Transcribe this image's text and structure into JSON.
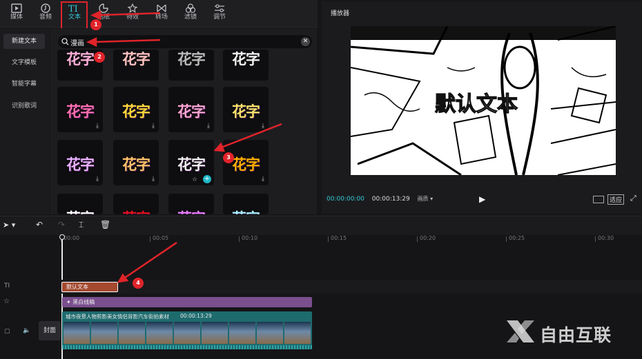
{
  "toolbar": {
    "tabs": [
      {
        "label": "媒体",
        "icon": "media-icon"
      },
      {
        "label": "音频",
        "icon": "audio-icon"
      },
      {
        "label": "文本",
        "icon": "text-icon"
      },
      {
        "label": "贴纸",
        "icon": "sticker-icon"
      },
      {
        "label": "特效",
        "icon": "effects-icon"
      },
      {
        "label": "转场",
        "icon": "transition-icon"
      },
      {
        "label": "滤镜",
        "icon": "filter-icon"
      },
      {
        "label": "调节",
        "icon": "adjust-icon"
      }
    ],
    "active": "文本"
  },
  "left_nav": {
    "items": [
      "新建文本",
      "文字模板",
      "智能字幕",
      "识别歌词"
    ],
    "selected": "新建文本"
  },
  "search": {
    "value": "漫画"
  },
  "library": {
    "tile_text": "花字",
    "partial_top_text": "花字",
    "tile_colors": [
      [
        "#ff6fb0",
        "#ffd93a",
        "#f7a6d0",
        "#f8e36a"
      ],
      [
        "#e8b2ff",
        "#ffc46a",
        "#f2f2f2",
        "#ffb000"
      ],
      [
        "#ffffff",
        "#e01020",
        "#e57cff",
        "#a8efff"
      ]
    ]
  },
  "player": {
    "title": "播放器",
    "overlay_text": "默认文本",
    "current_time": "00:00:00:00",
    "total_time": "00:00:13:29",
    "ratio_label": "画质",
    "ratio_btn": "适应"
  },
  "timeline": {
    "ruler": [
      "00:00",
      "00:05",
      "00:10",
      "00:15",
      "00:20",
      "00:25",
      "00:30"
    ],
    "text_clip": "默认文本",
    "effect_clip": "黑白线稿",
    "video_clip_name": "城市夜景人物剪影美女情侣背影汽车街拍素材",
    "video_clip_duration": "00:00:13:29",
    "cover_label": "封面"
  },
  "annotations": [
    "1",
    "2",
    "3",
    "4"
  ],
  "watermark": "自由互联",
  "colors": {
    "accent": "#35c8d8",
    "annotation": "#e0242a",
    "text_clip": "#a4492f",
    "effect_clip": "#7b4e8e",
    "video_clip": "#1e6b6e"
  }
}
